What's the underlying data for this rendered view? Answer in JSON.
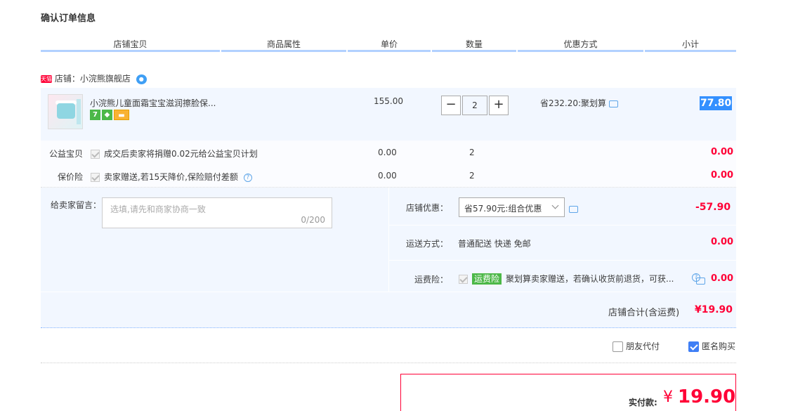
{
  "page_title": "确认订单信息",
  "headers": [
    "店铺宝贝",
    "商品属性",
    "单价",
    "数量",
    "优惠方式",
    "小计"
  ],
  "shop": {
    "badge": "天猫",
    "label": "店铺：",
    "name": "小浣熊旗舰店",
    "chat_icon": "wangwang-icon"
  },
  "item": {
    "title": "小浣熊儿童面霜宝宝滋润擦脸保...",
    "badges": [
      "7",
      "shield-icon",
      "card-icon"
    ],
    "price": "155.00",
    "quantity": "2",
    "minus": "−",
    "plus": "+",
    "discount": "省232.20:聚划算",
    "subtotal": "77.80"
  },
  "services": [
    {
      "label": "公益宝贝",
      "desc": "成交后卖家将捐赠0.02元给公益宝贝计划",
      "price": "0.00",
      "qty": "2",
      "subtotal": "0.00"
    },
    {
      "label": "保价险",
      "desc": "卖家赠送,若15天降价,保险赔付差额",
      "price": "0.00",
      "qty": "2",
      "subtotal": "0.00",
      "help": "?"
    }
  ],
  "memo": {
    "label": "给卖家留言：",
    "placeholder": "选填,请先和商家协商一致",
    "counter": "0/200"
  },
  "shop_discount": {
    "label": "店铺优惠：",
    "selected": "省57.90元:组合优惠",
    "amount": "-57.90"
  },
  "shipping": {
    "label": "运送方式：",
    "value": "普通配送 快递 免邮",
    "amount": "0.00"
  },
  "shipping_insurance": {
    "label": "运费险：",
    "tag": "运费险",
    "desc": "聚划算卖家赠送，若确认收货前退货，可获...",
    "amount": "0.00",
    "help": "?"
  },
  "shop_total": {
    "label": "店铺合计(含运费)",
    "value": "¥19.90"
  },
  "options": {
    "friend_pay": "朋友代付",
    "anonymous": "匿名购买"
  },
  "payment": {
    "label": "实付款:",
    "currency": "¥",
    "value": "19.90"
  },
  "colors": {
    "accent_red": "#ff0036",
    "header_rule": "#b2d1ff",
    "panel_bg": "#f2f7ff",
    "selection": "#3390ff",
    "green_tag": "#4cb848"
  }
}
